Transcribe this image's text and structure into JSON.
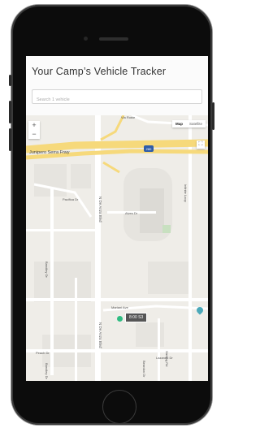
{
  "app": {
    "title": "Your Camp’s Vehicle Tracker"
  },
  "search": {
    "placeholder": "Search 1 vehicle"
  },
  "map_controls": {
    "zoom_in": "+",
    "zoom_out": "−",
    "map_label": "Map",
    "satellite_label": "Satellite",
    "fullscreen_glyph": "⛶"
  },
  "map_labels": {
    "highway": "Junipero Serra Frwy",
    "interstate_shield": "280",
    "road_vertical_1": "N De Anza Blvd",
    "road_vertical_2": "N De Anza Blvd",
    "road_top": "Via Roble",
    "road_mariani": "Mariani Ave",
    "road_left_1": "Bandley Dr",
    "road_left_2": "Bandley Dr",
    "road_left_3": "Pacifica Dr",
    "road_bottom": "Lazaneo Dr",
    "road_left_4": "Peach Dr",
    "road_right_1": "Infinite Loop",
    "road_right_2": "Stelling Rd",
    "road_small_1": "Alves Dr",
    "road_small_2": "Beardon Dr"
  },
  "vehicle": {
    "label": "8:00 S3",
    "marker_color": "#2fbd82"
  },
  "colors": {
    "highway": "#f6d97b",
    "map_bg": "#efede8",
    "road": "#ffffff",
    "block": "#e3e1dc"
  }
}
